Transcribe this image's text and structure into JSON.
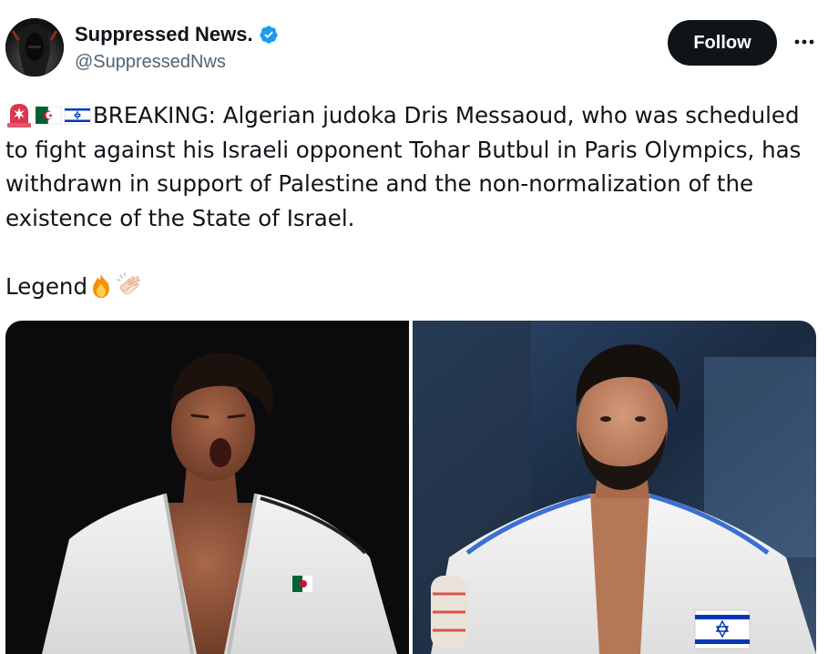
{
  "post": {
    "author": {
      "display_name": "Suppressed News.",
      "handle": "@SuppressedNws",
      "verified": true,
      "avatar_icon": "hooded-figure-avatar"
    },
    "follow_label": "Follow",
    "more_icon": "more-options-icon",
    "text_line_1": "BREAKING: Algerian judoka Dris Messaoud, who was scheduled to fight against his Israeli opponent Tohar Butbul in Paris Olympics, has withdrawn in support of Palestine and the non-normalization of the existence of the State of Israel.",
    "text_line_2": "Legend",
    "leading_emojis": [
      "rotating-light-emoji",
      "algeria-flag-emoji",
      "israel-flag-emoji"
    ],
    "trailing_emojis": [
      "fire-emoji",
      "clapping-hands-emoji"
    ],
    "media": [
      {
        "name": "photo-algerian-judoka",
        "description_icon": "judoka-white-gi-algeria-flag"
      },
      {
        "name": "photo-israeli-judoka",
        "description_icon": "judoka-white-gi-israel-flag"
      }
    ]
  },
  "colors": {
    "text_primary": "#0f1419",
    "text_secondary": "#536471",
    "verified_blue": "#1d9bf0",
    "follow_bg": "#0f1419",
    "follow_text": "#ffffff"
  }
}
